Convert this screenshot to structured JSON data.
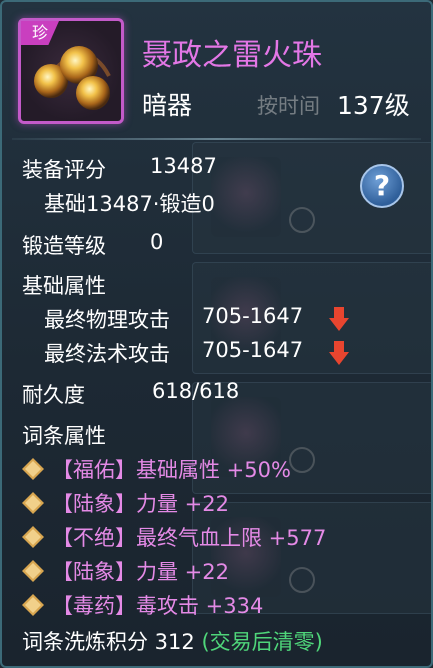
{
  "header": {
    "rarity_badge": "珍",
    "title": "聂政之雷火珠",
    "type": "暗器",
    "sort_label": "按时间",
    "level": "137级"
  },
  "stats": {
    "score_label": "装备评分",
    "score_value": "13487",
    "score_detail": "基础13487·锻造0",
    "forge_label": "锻造等级",
    "forge_value": "0",
    "base_attr_label": "基础属性",
    "phys_attack_label": "最终物理攻击",
    "phys_attack_value": "705-1647",
    "magic_attack_label": "最终法术攻击",
    "magic_attack_value": "705-1647",
    "durability_label": "耐久度",
    "durability_value": "618/618",
    "affix_label": "词条属性"
  },
  "affixes": [
    {
      "text": "【福佑】基础属性 +50%"
    },
    {
      "text": "【陆象】力量 +22"
    },
    {
      "text": "【不绝】最终气血上限 +577"
    },
    {
      "text": "【陆象】力量 +22"
    },
    {
      "text": "【毒药】毒攻击 +334"
    }
  ],
  "footer": {
    "refine_label": "词条洗炼积分 312",
    "refine_note": "(交易后清零)"
  },
  "help_button": "?",
  "colors": {
    "title": "#e377e6",
    "affix": "#e48ae6",
    "down_arrow": "#e8452f",
    "note_green": "#4fd67a",
    "border": "#3c6a78"
  }
}
